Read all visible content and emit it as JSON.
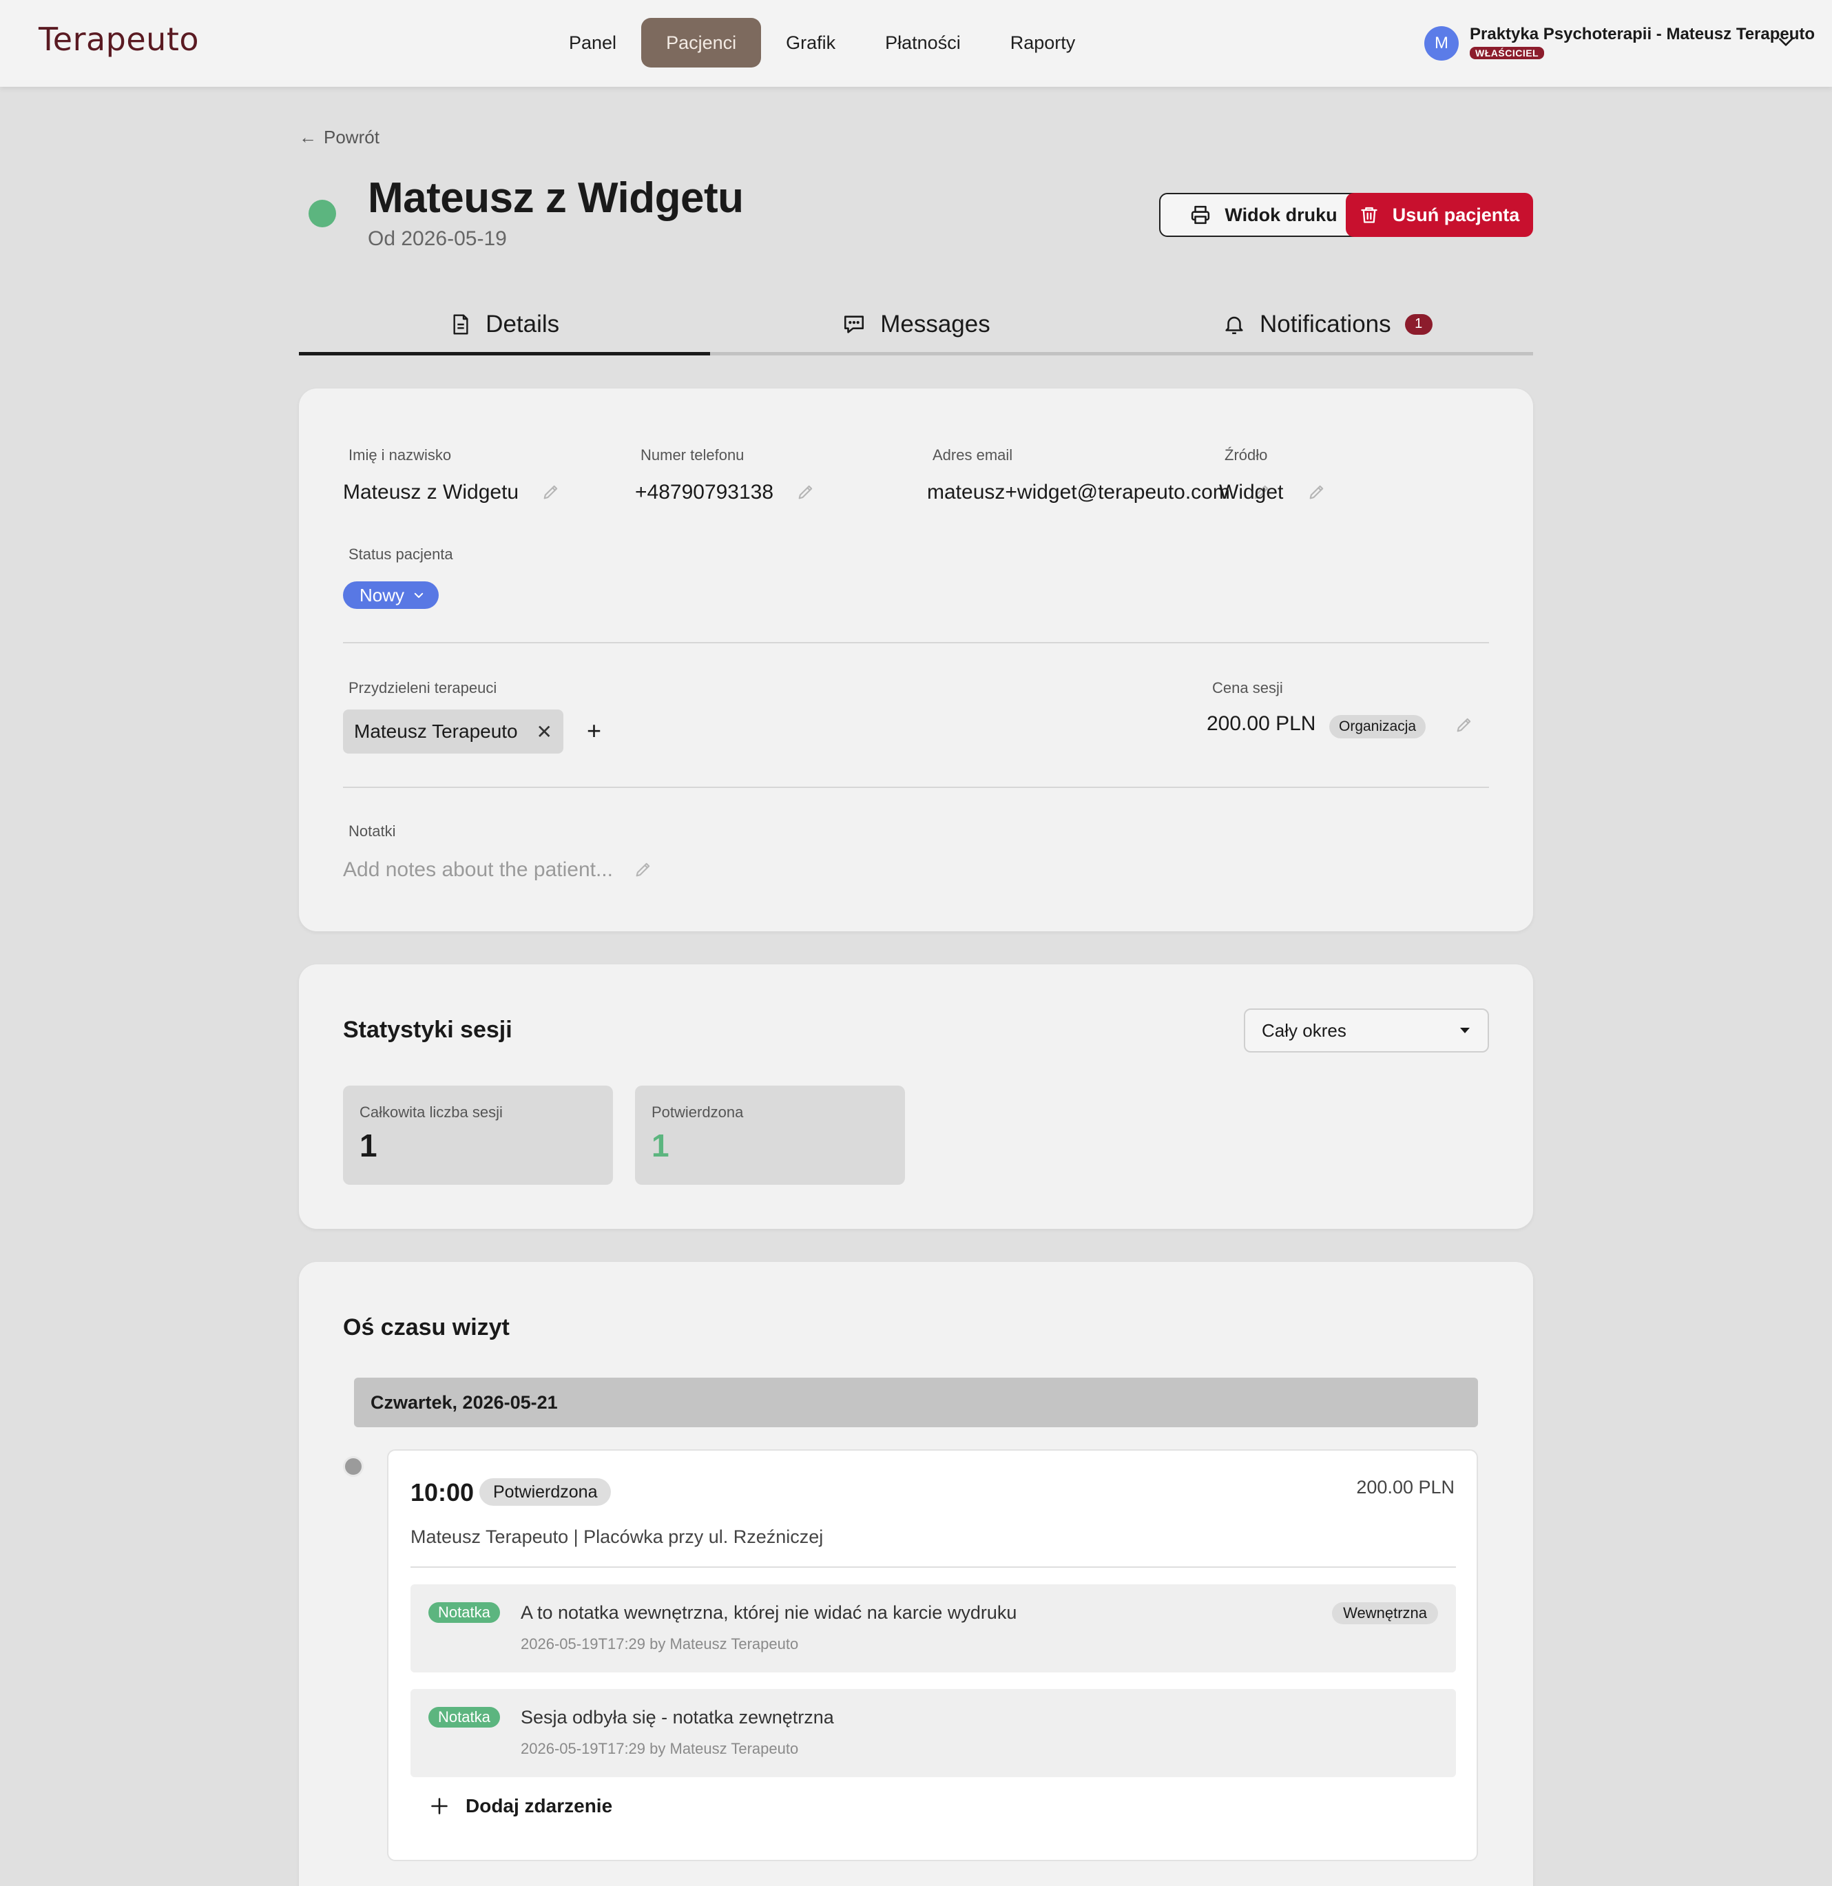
{
  "app": {
    "logo": "Terapeuto"
  },
  "nav": {
    "items": [
      {
        "label": "Panel",
        "active": false
      },
      {
        "label": "Pacjenci",
        "active": true
      },
      {
        "label": "Grafik",
        "active": false
      },
      {
        "label": "Płatności",
        "active": false
      },
      {
        "label": "Raporty",
        "active": false
      }
    ]
  },
  "account": {
    "avatar_initial": "M",
    "name": "Praktyka Psychoterapii - Mateusz Terapeuto",
    "role": "WŁAŚCICIEL"
  },
  "header": {
    "back_label": "Powrót",
    "patient_name": "Mateusz z Widgetu",
    "since": "Od 2026-05-19",
    "print_label": "Widok druku",
    "delete_label": "Usuń pacjenta"
  },
  "tabs": [
    {
      "label": "Details",
      "icon": "document-icon",
      "active": true
    },
    {
      "label": "Messages",
      "icon": "chat-icon",
      "active": false
    },
    {
      "label": "Notifications",
      "icon": "bell-icon",
      "active": false,
      "badge": "1"
    }
  ],
  "details": {
    "name_label": "Imię i nazwisko",
    "name_value": "Mateusz z Widgetu",
    "phone_label": "Numer telefonu",
    "phone_value": "+48790793138",
    "email_label": "Adres email",
    "email_value": "mateusz+widget@terapeuto.com",
    "source_label": "Źródło",
    "source_value": "Widget",
    "status_label": "Status pacjenta",
    "status_value": "Nowy",
    "therapists_label": "Przydzieleni terapeuci",
    "therapist_name": "Mateusz Terapeuto",
    "price_label": "Cena sesji",
    "price_value": "200.00 PLN",
    "price_badge": "Organizacja",
    "notes_label": "Notatki",
    "notes_placeholder": "Add notes about the patient..."
  },
  "stats": {
    "title": "Statystyki sesji",
    "period": "Cały okres",
    "total_label": "Całkowita liczba sesji",
    "total_value": "1",
    "confirmed_label": "Potwierdzona",
    "confirmed_value": "1"
  },
  "timeline": {
    "title": "Oś czasu wizyt",
    "date": "Czwartek, 2026-05-21",
    "event": {
      "time": "10:00",
      "status": "Potwierdzona",
      "price": "200.00 PLN",
      "meta": "Mateusz Terapeuto | Placówka przy ul. Rzeźniczej",
      "notes": [
        {
          "badge": "Notatka",
          "text": "A to notatka wewnętrzna, której nie widać na karcie wydruku",
          "meta": "2026-05-19T17:29 by Mateusz Terapeuto",
          "tag": "Wewnętrzna"
        },
        {
          "badge": "Notatka",
          "text": "Sesja odbyła się - notatka zewnętrzna",
          "meta": "2026-05-19T17:29 by Mateusz Terapeuto"
        }
      ],
      "add_label": "Dodaj zdarzenie"
    }
  },
  "colors": {
    "brand": "#5a1a22",
    "nav_active": "#7d6a5e",
    "danger": "#c8102e",
    "status_new": "#5878e4",
    "success": "#5cb57f",
    "badge": "#8c1c2c"
  }
}
